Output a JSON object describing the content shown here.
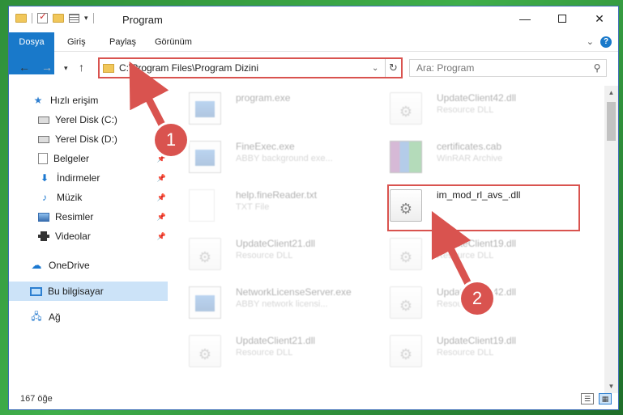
{
  "window": {
    "title": "Program",
    "controls": {
      "minimize": "—",
      "maximize": "",
      "close": "✕"
    }
  },
  "ribbon": {
    "tabs": [
      "Dosya",
      "Giriş",
      "Paylaş",
      "Görünüm"
    ],
    "help": "?"
  },
  "nav": {
    "address": "C:\\Program Files\\Program Dizini",
    "search_placeholder": "Ara: Program"
  },
  "sidebar": {
    "items": [
      {
        "label": "Hızlı erişim",
        "icon": "star-icon"
      },
      {
        "label": "Yerel Disk (C:)",
        "icon": "drive-icon"
      },
      {
        "label": "Yerel Disk (D:)",
        "icon": "drive-icon"
      },
      {
        "label": "Belgeler",
        "icon": "documents-icon",
        "pinned": true
      },
      {
        "label": "İndirmeler",
        "icon": "download-icon",
        "pinned": true
      },
      {
        "label": "Müzik",
        "icon": "music-icon",
        "pinned": true
      },
      {
        "label": "Resimler",
        "icon": "pictures-icon",
        "pinned": true
      },
      {
        "label": "Videolar",
        "icon": "video-icon",
        "pinned": true
      },
      {
        "label": "OneDrive",
        "icon": "cloud-icon"
      },
      {
        "label": "Bu bilgisayar",
        "icon": "computer-icon",
        "selected": true
      },
      {
        "label": "Ağ",
        "icon": "network-icon"
      }
    ]
  },
  "files": [
    {
      "name": "program.exe",
      "type": "",
      "icon": "exe-icon",
      "faded": true
    },
    {
      "name": "UpdateClient42.dll",
      "type": "Resource DLL",
      "icon": "dll-icon",
      "faded": true
    },
    {
      "name": "FineExec.exe",
      "type": "ABBY background exe...",
      "icon": "exe-icon",
      "faded": true
    },
    {
      "name": "certificates.cab",
      "type": "WinRAR Archive",
      "icon": "archive-icon",
      "faded": true
    },
    {
      "name": "help.fineReader.txt",
      "type": "TXT File",
      "icon": "text-file-icon",
      "faded": true
    },
    {
      "name": "im_mod_rl_avs_.dll",
      "type": "",
      "icon": "dll-icon",
      "faded": false
    },
    {
      "name": "UpdateClient21.dll",
      "type": "Resource DLL",
      "icon": "dll-icon",
      "faded": true
    },
    {
      "name": "UpdateClient19.dll",
      "type": "Resource DLL",
      "icon": "dll-icon",
      "faded": true
    },
    {
      "name": "NetworkLicenseServer.exe",
      "type": "ABBY network licensi...",
      "icon": "exe-icon",
      "faded": true
    },
    {
      "name": "UpdateClient42.dll",
      "type": "Resource DLL",
      "icon": "dll-icon",
      "faded": true
    },
    {
      "name": "UpdateClient21.dll",
      "type": "Resource DLL",
      "icon": "dll-icon",
      "faded": true
    },
    {
      "name": "UpdateClient19.dll",
      "type": "Resource DLL",
      "icon": "dll-icon",
      "faded": true
    }
  ],
  "status": {
    "count": "167 öğe"
  },
  "annotations": {
    "step1": "1",
    "step2": "2",
    "color": "#d9534f"
  }
}
